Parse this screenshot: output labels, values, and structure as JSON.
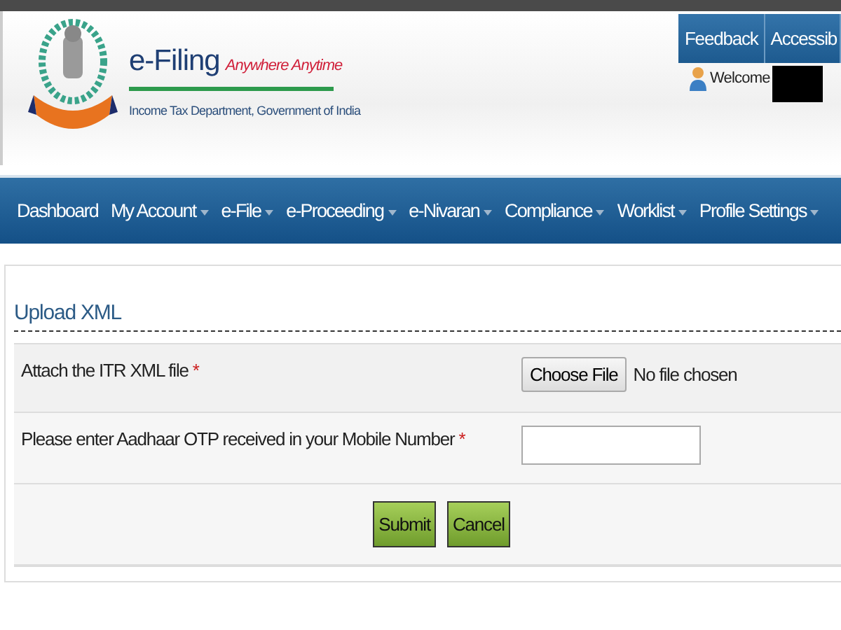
{
  "header": {
    "brand": "e-Filing",
    "tagline": "Anywhere Anytime",
    "department": "Income Tax Department, Government of India",
    "top_links": [
      "Feedback",
      "Accessib"
    ],
    "welcome": "Welcome"
  },
  "nav": [
    {
      "label": "Dashboard",
      "has_menu": false
    },
    {
      "label": "My Account",
      "has_menu": true
    },
    {
      "label": "e-File",
      "has_menu": true
    },
    {
      "label": "e-Proceeding",
      "has_menu": true
    },
    {
      "label": "e-Nivaran",
      "has_menu": true
    },
    {
      "label": "Compliance",
      "has_menu": true
    },
    {
      "label": "Worklist",
      "has_menu": true
    },
    {
      "label": "Profile Settings",
      "has_menu": true
    }
  ],
  "form": {
    "title": "Upload XML",
    "file_field": {
      "label": "Attach the ITR XML file",
      "required_mark": "*",
      "button": "Choose File",
      "status": "No file chosen"
    },
    "otp_field": {
      "label": "Please enter Aadhaar OTP received in your Mobile Number",
      "required_mark": "*"
    },
    "buttons": [
      "Submit",
      "Cancel"
    ]
  }
}
